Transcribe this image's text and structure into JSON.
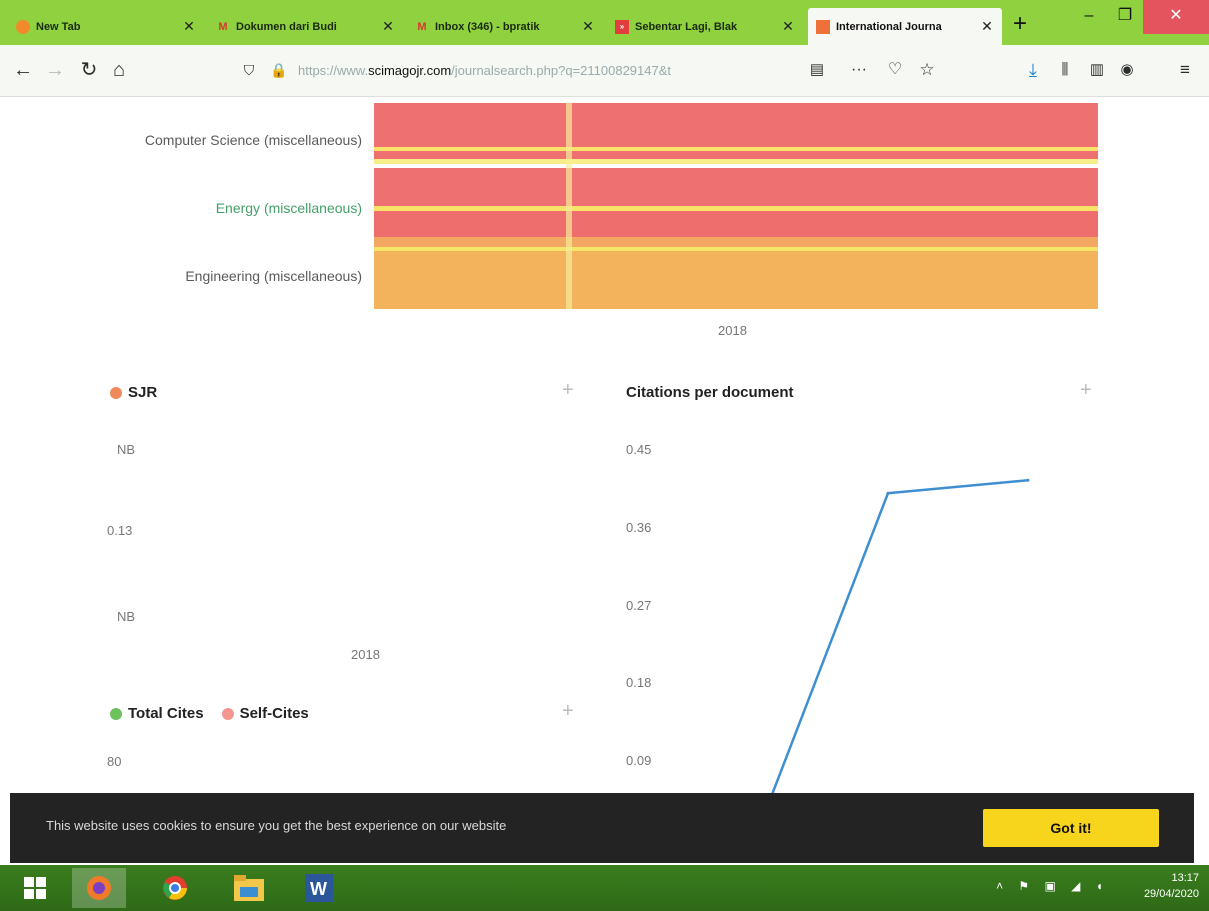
{
  "browser": {
    "tabs": [
      {
        "title": "New Tab",
        "icon": "firefox-icon"
      },
      {
        "title": "Dokumen dari Budi",
        "icon": "gmail-icon"
      },
      {
        "title": "Inbox (346) - bpratik",
        "icon": "gmail-icon"
      },
      {
        "title": "Sebentar Lagi, Blak",
        "icon": "news-icon"
      },
      {
        "title": "International Journa",
        "icon": "sjr-icon",
        "active": true
      }
    ],
    "url_prefix": "https://www.",
    "url_host": "scimagojr.com",
    "url_path": "/journalsearch.php?q=21100829147&t"
  },
  "heatmap": {
    "categories": [
      "Computer Science (miscellaneous)",
      "Energy (miscellaneous)",
      "Engineering (miscellaneous)"
    ],
    "x_label": "2018"
  },
  "sjr": {
    "title": "SJR",
    "ticks": [
      "NB",
      "0.13",
      "NB"
    ],
    "x_label": "2018",
    "color": "#f08a5d"
  },
  "cites_legend": {
    "total": "Total Cites",
    "self": "Self-Cites",
    "total_color": "#6cc35c",
    "self_color": "#f2968f",
    "tick": "80"
  },
  "chart_data": {
    "type": "line",
    "title": "Citations per document",
    "ytick_labels": [
      "0.45",
      "0.36",
      "0.27",
      "0.18",
      "0.09"
    ],
    "ylim": [
      0,
      0.45
    ],
    "x": [
      0,
      1,
      2
    ],
    "series": [
      {
        "values": [
          0.0,
          0.4,
          0.415
        ]
      }
    ],
    "color": "#3d8fd1"
  },
  "cookie": {
    "text": "This website uses cookies to ensure you get the best experience on our website",
    "button": "Got it!"
  },
  "taskbar": {
    "time": "13:17",
    "date": "29/04/2020"
  }
}
